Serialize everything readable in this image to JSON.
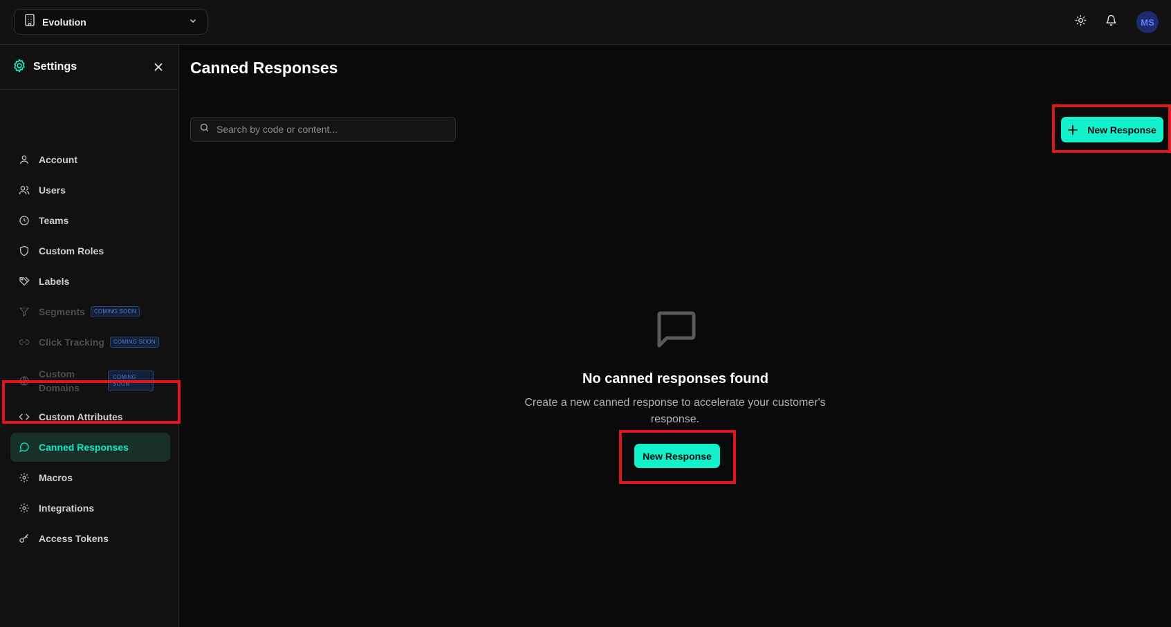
{
  "topbar": {
    "workspace_name": "Evolution",
    "avatar_initials": "MS"
  },
  "sidebar": {
    "title": "Settings",
    "items": [
      {
        "label": "Account",
        "icon": "user-icon",
        "state": "normal"
      },
      {
        "label": "Users",
        "icon": "users-icon",
        "state": "normal"
      },
      {
        "label": "Teams",
        "icon": "clock-icon",
        "state": "normal"
      },
      {
        "label": "Custom Roles",
        "icon": "shield-icon",
        "state": "normal"
      },
      {
        "label": "Labels",
        "icon": "tags-icon",
        "state": "normal"
      },
      {
        "label": "Segments",
        "icon": "filter-icon",
        "state": "disabled",
        "badge": "COMING SOON"
      },
      {
        "label": "Click Tracking",
        "icon": "link-icon",
        "state": "disabled",
        "badge": "COMING SOON"
      },
      {
        "label": "Custom Domains",
        "icon": "globe-icon",
        "state": "disabled",
        "badge": "COMING SOON"
      },
      {
        "label": "Custom Attributes",
        "icon": "code-icon",
        "state": "normal"
      },
      {
        "label": "Canned Responses",
        "icon": "message-circle-icon",
        "state": "active"
      },
      {
        "label": "Macros",
        "icon": "gear-icon",
        "state": "normal"
      },
      {
        "label": "Integrations",
        "icon": "gear-icon",
        "state": "normal"
      },
      {
        "label": "Access Tokens",
        "icon": "key-icon",
        "state": "normal"
      }
    ]
  },
  "main": {
    "title": "Canned Responses",
    "search_placeholder": "Search by code or content...",
    "new_button_label": "New Response",
    "empty_title": "No canned responses found",
    "empty_description": "Create a new canned response to accelerate your customer's response.",
    "empty_button_label": "New Response"
  },
  "colors": {
    "accent": "#13f0cc",
    "active_bg": "#183029",
    "highlight": "#e0161d"
  }
}
